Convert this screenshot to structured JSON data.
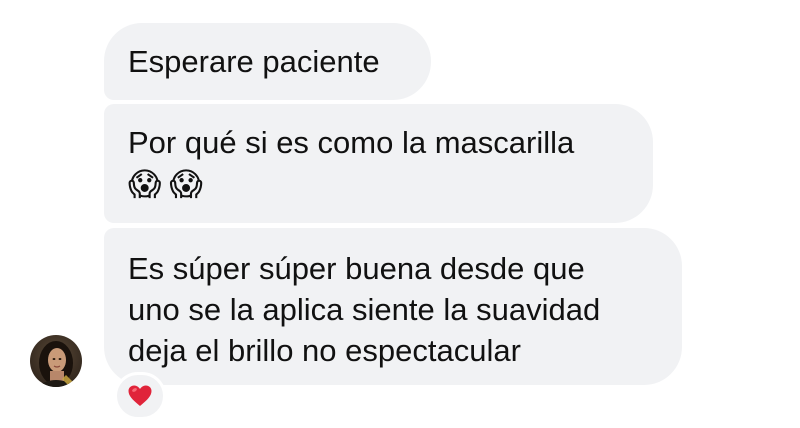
{
  "messages": [
    {
      "lines": [
        "Esperare paciente"
      ]
    },
    {
      "lines": [
        "Por qué si es como la mascarilla"
      ],
      "emojis": [
        "😱",
        "😱"
      ],
      "emoji_names": [
        "face-screaming-icon",
        "face-screaming-icon"
      ]
    },
    {
      "lines": [
        "Es súper súper buena desde que",
        "uno se la aplica siente la suavidad",
        "deja el brillo no espectacular"
      ],
      "reaction": "heart-icon"
    }
  ],
  "colors": {
    "bubble_background": "#f1f2f4",
    "text": "#111111",
    "page_background": "#ffffff",
    "heart": "#e0243a"
  },
  "sender": {
    "avatar": "avatar-photo"
  }
}
